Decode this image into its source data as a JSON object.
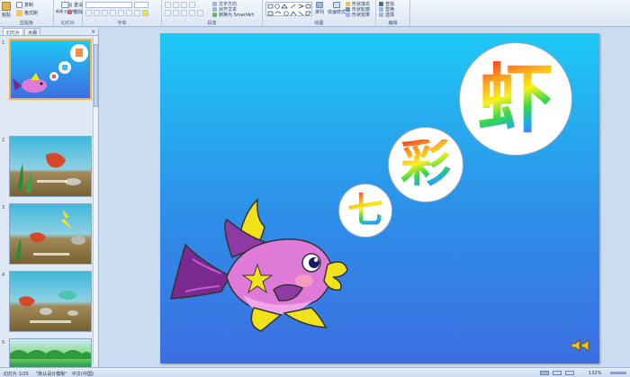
{
  "ribbon": {
    "clipboard": {
      "paste": "粘贴",
      "copy": "复制",
      "format_painter": "格式刷",
      "label": "剪贴板"
    },
    "slides": {
      "new_slide": "新建\n幻灯片",
      "reset": "重设",
      "delete": "删除",
      "label": "幻灯片"
    },
    "font": {
      "label": "字体"
    },
    "paragraph": {
      "text_direction": "文字方向",
      "align_text": "对齐文本",
      "smartart": "转换为 SmartArt",
      "label": "段落"
    },
    "drawing": {
      "arrange": "排列",
      "quick_styles": "快速样式",
      "shape_fill": "形状填充",
      "shape_outline": "形状轮廓",
      "shape_effects": "形状效果",
      "label": "绘图"
    },
    "editing": {
      "find": "查找",
      "replace": "替换",
      "select": "选择",
      "label": "编辑"
    }
  },
  "panel": {
    "tabs": [
      {
        "label": "幻灯片"
      },
      {
        "label": "大纲"
      }
    ],
    "close": "×",
    "thumbnails": [
      {
        "num": "1"
      },
      {
        "num": "2"
      },
      {
        "num": "3"
      },
      {
        "num": "4"
      },
      {
        "num": "5"
      }
    ]
  },
  "slide": {
    "chars": [
      "虾",
      "彩",
      "七"
    ]
  },
  "status": {
    "slide_info": "幻灯片 1/25",
    "theme": "\"默认设计模板\"",
    "language": "中文(中国)",
    "zoom": "132%"
  },
  "colors": {
    "slide_top": "#1ec8f6",
    "slide_bottom": "#3c6fe1",
    "fish_body": "#e07ad8",
    "fish_fin": "#7a2a8f",
    "fish_yellow": "#f2e21b"
  }
}
